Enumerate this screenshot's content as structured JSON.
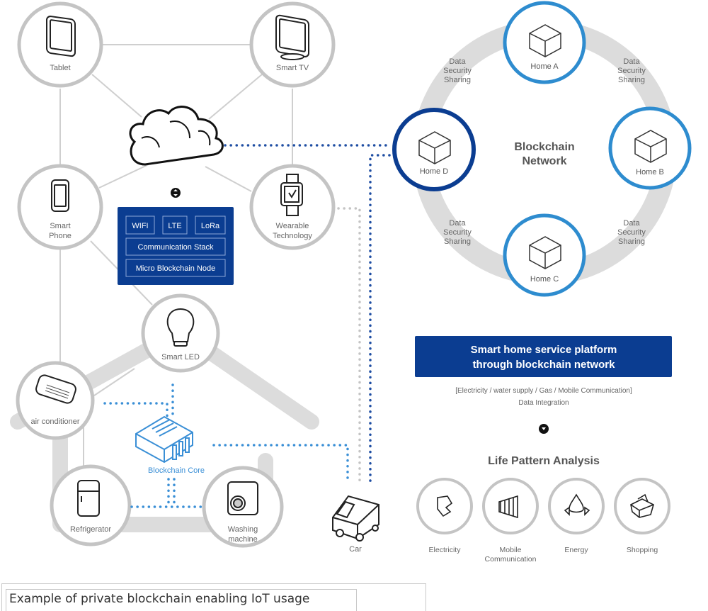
{
  "colors": {
    "navy": "#0b3d91",
    "light_blue": "#2e8ccf",
    "core_blue": "#3a8fd6",
    "gray_ring": "#c4c4c4",
    "text_gray": "#666666"
  },
  "devices": {
    "tablet": {
      "label": "Tablet",
      "icon": "tablet-icon"
    },
    "smart_tv": {
      "label": "Smart TV",
      "icon": "tv-icon"
    },
    "smart_phone": {
      "label_line1": "Smart",
      "label_line2": "Phone",
      "icon": "smartphone-icon"
    },
    "wearable": {
      "label_line1": "Wearable",
      "label_line2": "Technology",
      "icon": "watch-icon"
    },
    "cloud": {
      "icon": "cloud-icon"
    }
  },
  "node_box": {
    "protocols": [
      "WIFI",
      "LTE",
      "LoRa"
    ],
    "stack": "Communication Stack",
    "node": "Micro Blockchain Node"
  },
  "home_devices": {
    "smart_led": {
      "label": "Smart LED",
      "icon": "lightbulb-icon"
    },
    "air_conditioner": {
      "label": "air conditioner",
      "icon": "air-conditioner-icon"
    },
    "refrigerator": {
      "label": "Refrigerator",
      "icon": "refrigerator-icon"
    },
    "washing_machine": {
      "label_line1": "Washing",
      "label_line2": "machine",
      "icon": "washing-machine-icon"
    },
    "blockchain_core": {
      "label": "Blockchain Core",
      "icon": "chip-icon"
    },
    "car": {
      "label": "Car",
      "icon": "van-icon"
    }
  },
  "network": {
    "title_line1": "Blockchain",
    "title_line2": "Network",
    "homes": [
      "Home A",
      "Home B",
      "Home C",
      "Home D"
    ],
    "link_label": [
      "Data",
      "Security",
      "Sharing"
    ]
  },
  "platform": {
    "banner_line1": "Smart home service platform",
    "banner_line2": "through blockchain network",
    "integration_line1": "[Electricity / water supply / Gas / Mobile Communication]",
    "integration_line2": "Data Integration",
    "analysis_title": "Life Pattern Analysis",
    "categories": [
      {
        "label_line1": "Electricity",
        "label_line2": "",
        "icon": "electricity-icon"
      },
      {
        "label_line1": "Mobile",
        "label_line2": "Communication",
        "icon": "signal-icon"
      },
      {
        "label_line1": "Energy",
        "label_line2": "",
        "icon": "energy-icon"
      },
      {
        "label_line1": "Shopping",
        "label_line2": "",
        "icon": "shopping-basket-icon"
      }
    ]
  },
  "caption": "Example of private blockchain enabling IoT usage"
}
